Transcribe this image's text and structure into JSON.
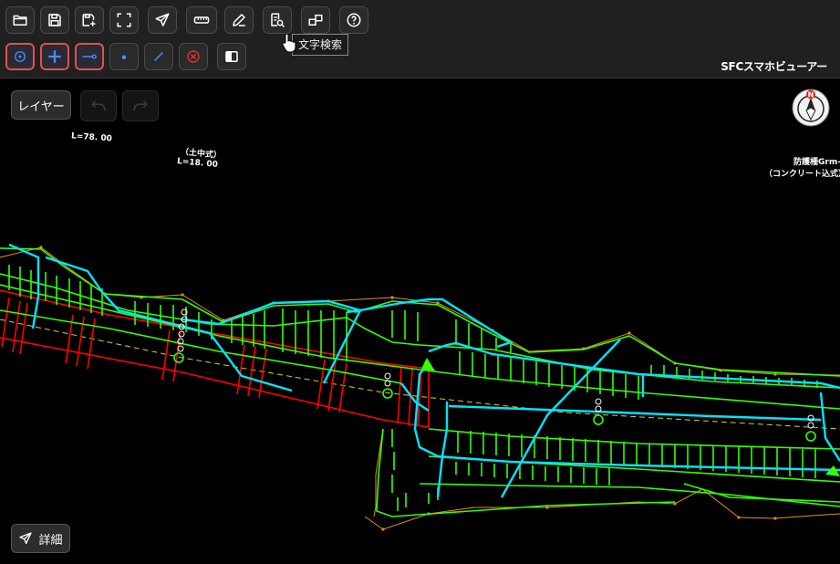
{
  "app": {
    "title": "SFCスマホビューアー"
  },
  "toolbar": {
    "row1": [
      {
        "name": "open-file-button",
        "icon": "folder-icon"
      },
      {
        "name": "save-button",
        "icon": "save-icon"
      },
      {
        "name": "save-as-button",
        "icon": "save-as-icon"
      },
      {
        "name": "fullscreen-button",
        "icon": "fullscreen-icon"
      },
      {
        "name": "navigate-button",
        "icon": "send-icon"
      },
      {
        "name": "measure-button",
        "icon": "ruler-icon"
      },
      {
        "name": "edit-button",
        "icon": "pen-icon"
      },
      {
        "name": "text-search-button",
        "icon": "doc-search-icon"
      },
      {
        "name": "window-button",
        "icon": "windows-icon"
      },
      {
        "name": "help-button",
        "icon": "help-icon"
      }
    ],
    "row2": [
      {
        "name": "snap-center-button",
        "icon": "target-icon",
        "selected": true
      },
      {
        "name": "snap-cross-button",
        "icon": "plus-icon",
        "selected": true
      },
      {
        "name": "snap-endpoint-button",
        "icon": "line-end-icon",
        "selected": true
      },
      {
        "name": "point-mode-button",
        "icon": "dot-icon",
        "selected": false
      },
      {
        "name": "line-mode-button",
        "icon": "slash-icon",
        "selected": false
      },
      {
        "name": "clear-button",
        "icon": "cancel-icon",
        "selected": false
      },
      {
        "name": "contrast-button",
        "icon": "contrast-icon",
        "selected": false
      }
    ],
    "tooltip": "文字検索"
  },
  "overlay": {
    "layer_label": "レイヤー",
    "detail_label": "詳細",
    "compass_letter": "N"
  },
  "drawing_text": {
    "l1": "L=78. 00",
    "l2": "（土中式）",
    "l3": "L=18. 00",
    "r1": "防護柵Grm-A-E",
    "r2": "（コンクリート込式）L="
  },
  "colors": {
    "toolbar_bg": "#202020",
    "canvas_bg": "#000000",
    "selected_border": "#e05050",
    "accent_blue": "#4a8cff",
    "cad_green": "#33ff00",
    "cad_cyan": "#00e5ff",
    "cad_red": "#ff0000",
    "cad_orange": "#e09020",
    "cad_yellow": "#d8d020"
  }
}
